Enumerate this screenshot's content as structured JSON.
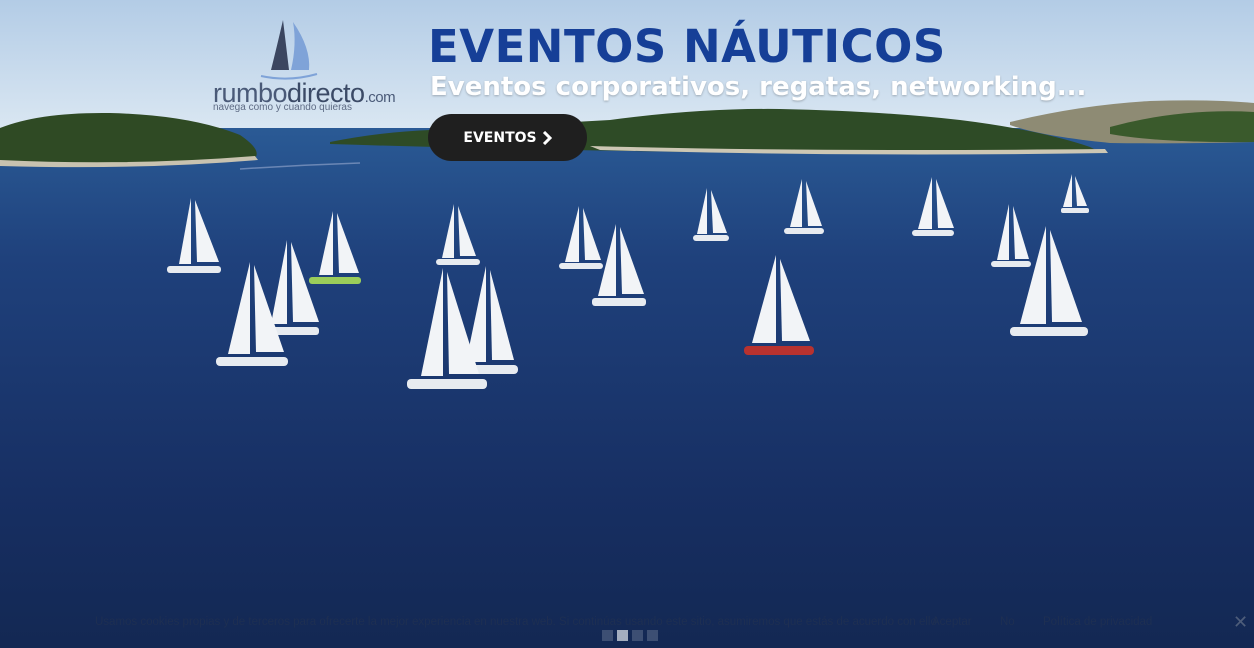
{
  "brand": {
    "name_part1": "rumbo",
    "name_part2": "directo",
    "name_domain": ".com",
    "tagline": "navega como y cuando quieras"
  },
  "hero": {
    "title": "EVENTOS NÁUTICOS",
    "subtitle": "Eventos corporativos, regatas, networking...",
    "cta_label": "EVENTOS",
    "cta_icon": "chevron-right-icon"
  },
  "cookie_bar": {
    "message": "Usamos cookies propias y de terceros para ofrecerte la mejor experiencia en nuestra web. Si continúas usando este sitio, asumiremos que estás de acuerdo con ello",
    "accept_label": "Aceptar",
    "reject_label": "No",
    "policy_label": "Política de privacidad",
    "close_icon": "close-icon"
  },
  "slider": {
    "slide_count": 4,
    "active_index": 1
  },
  "colors": {
    "title": "#163f97",
    "button_bg": "#1f1f1f",
    "sea": "#1d3a72",
    "sky": "#c7dcef"
  }
}
